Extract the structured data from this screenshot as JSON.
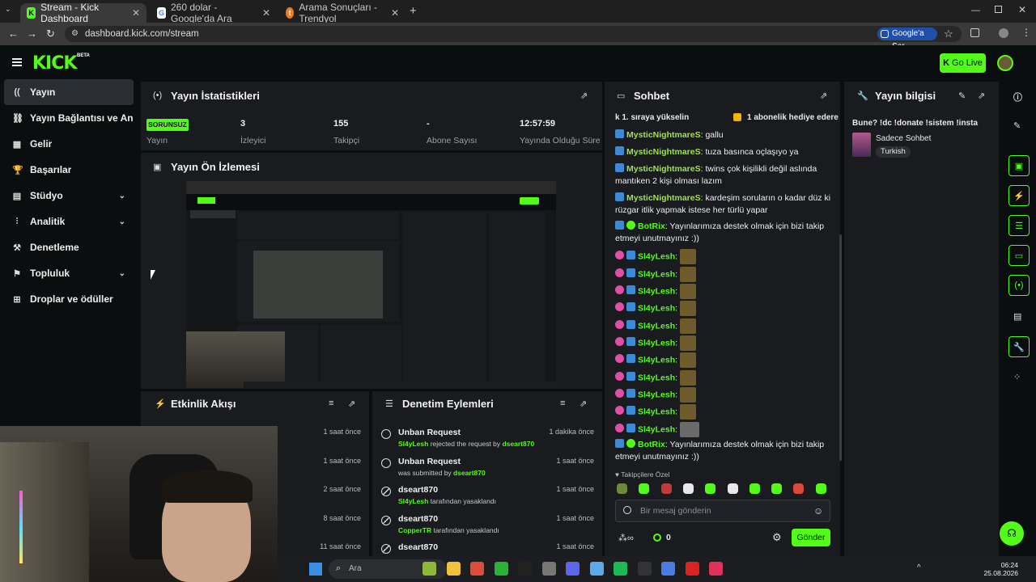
{
  "browser": {
    "tabs": [
      {
        "title": "Stream - Kick Dashboard",
        "active": true
      },
      {
        "title": "260 dolar - Google'da Ara",
        "active": false
      },
      {
        "title": "Arama Sonuçları - Trendyol",
        "active": false
      }
    ],
    "url": "dashboard.kick.com/stream",
    "google_ask_label": "Google'a Sor"
  },
  "header": {
    "logo": "KICK",
    "beta": "BETA",
    "go_live_label": "Go Live"
  },
  "sidebar": {
    "items": [
      {
        "label": "Yayın",
        "icon": "broadcast-icon",
        "active": true,
        "expandable": false
      },
      {
        "label": "Yayın Bağlantısı ve Anahtar",
        "icon": "link-icon",
        "active": false,
        "expandable": false
      },
      {
        "label": "Gelir",
        "icon": "revenue-icon",
        "active": false,
        "expandable": false
      },
      {
        "label": "Başarılar",
        "icon": "trophy-icon",
        "active": false,
        "expandable": false
      },
      {
        "label": "Stüdyo",
        "icon": "studio-icon",
        "active": false,
        "expandable": true
      },
      {
        "label": "Analitik",
        "icon": "analytics-icon",
        "active": false,
        "expandable": true
      },
      {
        "label": "Denetleme",
        "icon": "moderation-icon",
        "active": false,
        "expandable": false
      },
      {
        "label": "Topluluk",
        "icon": "community-icon",
        "active": false,
        "expandable": true
      },
      {
        "label": "Droplar ve ödüller",
        "icon": "drops-icon",
        "active": false,
        "expandable": false
      }
    ]
  },
  "stats": {
    "title": "Yayın İstatistikleri",
    "health_badge": "SORUNSUZ",
    "items": [
      {
        "label": "Yayın",
        "value": ""
      },
      {
        "label": "İzleyici",
        "value": "3"
      },
      {
        "label": "Takipçi",
        "value": "155"
      },
      {
        "label": "Abone Sayısı",
        "value": "-"
      },
      {
        "label": "Yayında Olduğu Süre",
        "value": "12:57:59"
      }
    ]
  },
  "preview": {
    "title": "Yayın Ön İzlemesi"
  },
  "activity": {
    "title": "Etkinlik Akışı",
    "rows": [
      {
        "time": "1 saat önce"
      },
      {
        "time": "1 saat önce"
      },
      {
        "time": "2 saat önce"
      },
      {
        "time": "8 saat önce"
      },
      {
        "time": "11 saat önce"
      }
    ]
  },
  "moderation": {
    "title": "Denetim Eylemleri",
    "rows": [
      {
        "icon": "undo-icon",
        "title": "Unban Request",
        "user": "Sl4yLesh",
        "text": " rejected the request by ",
        "user2": "dseart870",
        "after": "",
        "time": "1 dakika önce"
      },
      {
        "icon": "undo-icon",
        "title": "Unban Request",
        "user": "",
        "text": "was submitted by ",
        "user2": "dseart870",
        "after": "",
        "time": "1 saat önce"
      },
      {
        "icon": "ban-icon",
        "title": "dseart870",
        "user": "Sl4yLesh",
        "text": " tarafından yasaklandı",
        "user2": "",
        "after": "",
        "time": "1 saat önce"
      },
      {
        "icon": "ban-icon",
        "title": "dseart870",
        "user": "CopperTR",
        "text": " tarafından yasaklandı",
        "user2": "",
        "after": "",
        "time": "1 saat önce"
      },
      {
        "icon": "ban-icon",
        "title": "dseart870",
        "user": "",
        "text": "",
        "user2": "",
        "after": "",
        "time": "1 saat önce"
      }
    ]
  },
  "chat": {
    "title": "Sohbet",
    "pinned_left": "k 1. sıraya yükselin",
    "pinned_right": "1 abonelik hediye edere",
    "messages": [
      {
        "user": "MysticNightmareS",
        "color": "#9fe34a",
        "badge": "b",
        "text": "gallu"
      },
      {
        "user": "MysticNightmareS",
        "color": "#9fe34a",
        "badge": "b",
        "text": "tuza basınca oçlaşıyo ya"
      },
      {
        "user": "MysticNightmareS",
        "color": "#9fe34a",
        "badge": "b",
        "text": "twins çok kişilikli değil aslında mantıken 2 kişi olması lazım"
      },
      {
        "user": "MysticNightmareS",
        "color": "#9fe34a",
        "badge": "b",
        "text": "kardeşim soruların o kadar düz ki rüzgar itlik yapmak istese her türlü yapar"
      },
      {
        "user": "BotRix",
        "color": "#53fc18",
        "badge": "bv",
        "text": "Yayınlarımıza destek olmak için bizi takip etmeyi unutmayınız :))"
      },
      {
        "user": "Sl4yLesh",
        "color": "#53fc18",
        "badge": "pb",
        "text": "",
        "emote": true
      },
      {
        "user": "Sl4yLesh",
        "color": "#53fc18",
        "badge": "pb",
        "text": "",
        "emote": true
      },
      {
        "user": "Sl4yLesh",
        "color": "#53fc18",
        "badge": "pb",
        "text": "",
        "emote": true
      },
      {
        "user": "Sl4yLesh",
        "color": "#53fc18",
        "badge": "pb",
        "text": "",
        "emote": true
      },
      {
        "user": "Sl4yLesh",
        "color": "#53fc18",
        "badge": "pb",
        "text": "",
        "emote": true
      },
      {
        "user": "Sl4yLesh",
        "color": "#53fc18",
        "badge": "pb",
        "text": "",
        "emote": true
      },
      {
        "user": "Sl4yLesh",
        "color": "#53fc18",
        "badge": "pb",
        "text": "",
        "emote": true
      },
      {
        "user": "Sl4yLesh",
        "color": "#53fc18",
        "badge": "pb",
        "text": "",
        "emote": true
      },
      {
        "user": "Sl4yLesh",
        "color": "#53fc18",
        "badge": "pb",
        "text": "",
        "emote": true
      },
      {
        "user": "Sl4yLesh",
        "color": "#53fc18",
        "badge": "pb",
        "text": "",
        "emote": true
      },
      {
        "user": "Sl4yLesh",
        "color": "#53fc18",
        "badge": "pb",
        "text": "",
        "emote": true
      },
      {
        "user": "BotRix",
        "color": "#53fc18",
        "badge": "bv",
        "text": "Yayınlarımıza destek olmak için bizi takip etmeyi unutmayınız :))"
      }
    ],
    "followers_only": "Takipçilere Özel",
    "input_placeholder": "Bir mesaj gönderin",
    "points": "0",
    "send_label": "Gönder"
  },
  "stream_info": {
    "title": "Yayın bilgisi",
    "stream_title": "Bune? !dc !donate !sistem !insta",
    "category": "Sadece Sohbet",
    "tag": "Turkish"
  },
  "taskbar": {
    "search_label": "Ara",
    "time": "06:24",
    "date": "25.08.2026"
  },
  "colors": {
    "accent": "#53fc18",
    "panel": "#191b1f",
    "background": "#0b0e0f"
  }
}
